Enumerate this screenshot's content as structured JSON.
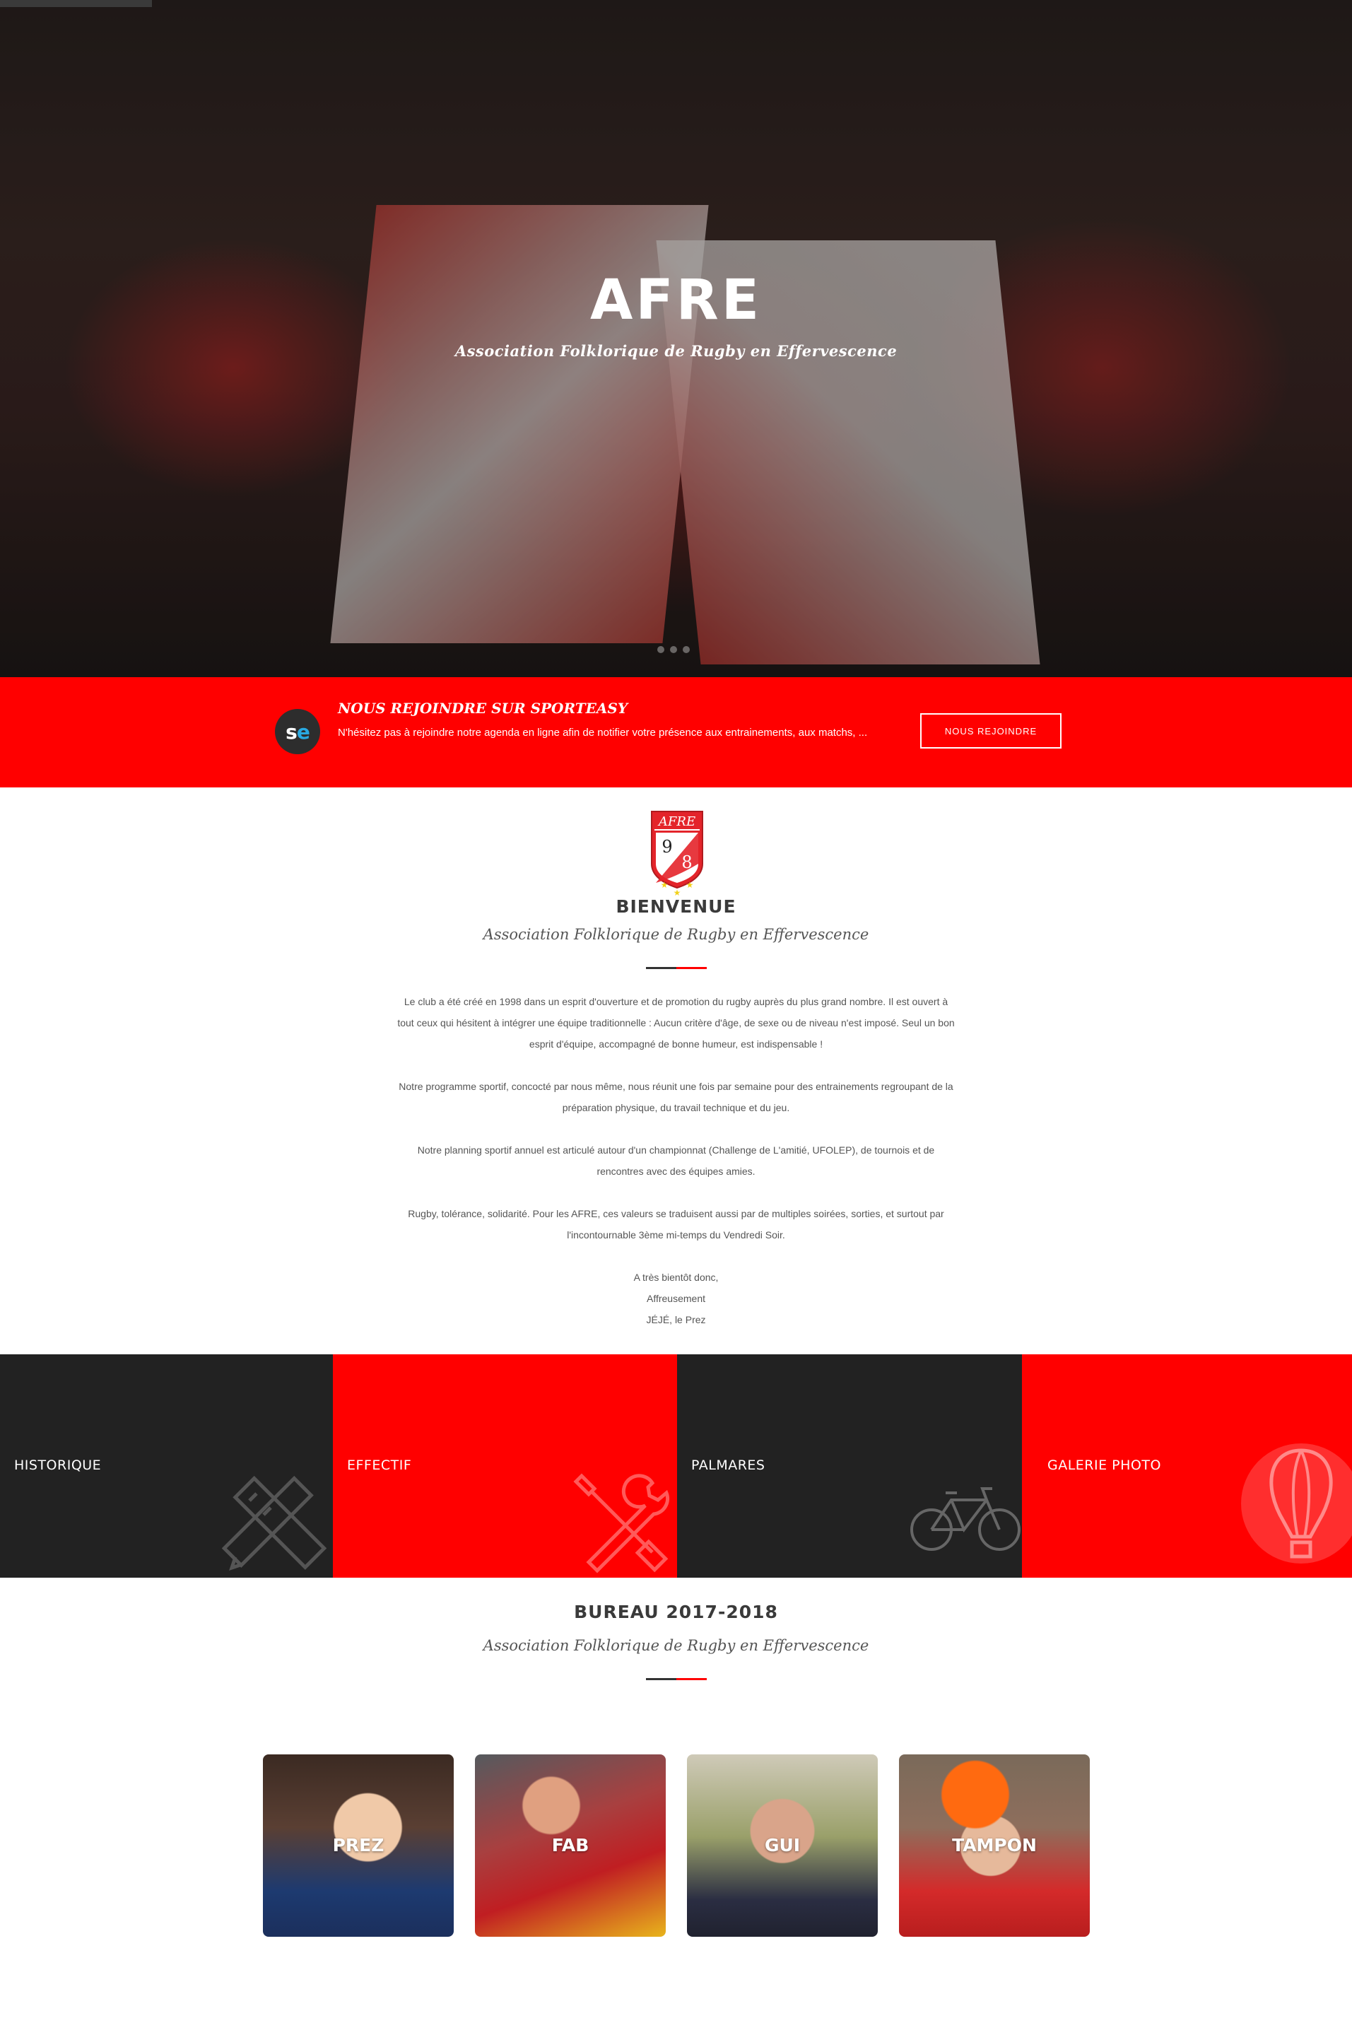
{
  "hero": {
    "title": "AFRE",
    "subtitle": "Association Folklorique de Rugby en Effervescence"
  },
  "banner": {
    "logo_text": "se",
    "title": "NOUS REJOINDRE SUR SPORTEASY",
    "text": "N'hésitez pas à rejoindre notre agenda en ligne afin de notifier votre présence aux entrainements, aux matchs, ...",
    "button": "NOUS REJOINDRE"
  },
  "welcome": {
    "crest_text": "AFRE",
    "crest_digits": [
      "9",
      "8"
    ],
    "title": "BIENVENUE",
    "subtitle": "Association Folklorique de Rugby en Effervescence",
    "paragraphs": [
      "Le club a été créé en 1998 dans un esprit d'ouverture et de promotion du rugby auprès du plus grand nombre. Il est ouvert à tout ceux qui hésitent à intégrer une équipe traditionnelle : Aucun critère d'âge, de sexe ou de niveau n'est imposé. Seul un bon esprit d'équipe, accompagné de bonne humeur, est indispensable !",
      "Notre programme sportif, concocté par nous même, nous réunit une fois par semaine pour des entrainements regroupant de la préparation physique, du travail technique et du jeu.",
      "Notre planning sportif annuel est articulé autour d'un championnat (Challenge de L'amitié, UFOLEP), de tournois et de rencontres avec des équipes amies.",
      "Rugby, tolérance, solidarité. Pour les AFRE, ces valeurs se traduisent aussi par de multiples soirées, sorties, et surtout par l'incontournable 3ème mi-temps du Vendredi Soir."
    ],
    "closing": [
      "A très bientôt donc,",
      "Affreusement",
      "JÉJÉ, le Prez"
    ]
  },
  "tiles": [
    {
      "label": "HISTORIQUE",
      "icon": "pencil-ruler-icon"
    },
    {
      "label": "EFFECTIF",
      "icon": "tools-icon"
    },
    {
      "label": "PALMARES",
      "icon": "bicycle-icon"
    },
    {
      "label": "GALERIE PHOTO",
      "icon": "balloon-icon"
    }
  ],
  "bureau": {
    "title": "BUREAU 2017-2018",
    "subtitle": "Association Folklorique de Rugby en Effervescence",
    "members": [
      "PREZ",
      "FAB",
      "GUI",
      "TAMPON"
    ]
  },
  "colors": {
    "brand_red": "#ff0000",
    "dark_tile": "#222222",
    "sporteasy_blue": "#29a9e1"
  }
}
